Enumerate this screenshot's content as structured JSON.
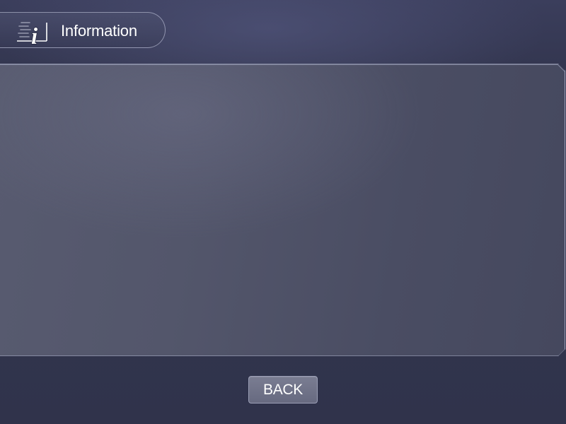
{
  "header": {
    "title": "Information",
    "icon": "info-icon"
  },
  "footer": {
    "back_label": "BACK"
  },
  "colors": {
    "background": "#30334b",
    "panel": "#53566b",
    "button": "#6f7288",
    "text": "#ffffff"
  }
}
